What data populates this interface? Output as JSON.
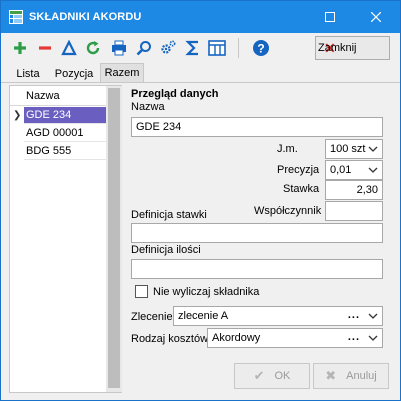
{
  "window": {
    "title": "SKŁADNIKI AKORDU",
    "accent_color": "#1e88e5"
  },
  "toolbar": {
    "icons": [
      "add-icon",
      "remove-icon",
      "delta-icon",
      "refresh-icon",
      "print-icon",
      "search-icon",
      "settings-icon",
      "sum-icon",
      "columns-icon",
      "help-icon"
    ],
    "close_label": "Zamknij"
  },
  "tabs": [
    {
      "label": "Lista",
      "active": false
    },
    {
      "label": "Pozycja",
      "active": false
    },
    {
      "label": "Razem",
      "active": true
    }
  ],
  "list": {
    "header": "Nazwa",
    "rows": [
      {
        "label": "GDE 234",
        "selected": true
      },
      {
        "label": "AGD 00001",
        "selected": false
      },
      {
        "label": "BDG 555",
        "selected": false
      }
    ],
    "selection_color": "#6a5fc1"
  },
  "detail": {
    "section_title": "Przegląd danych",
    "nazwa_label": "Nazwa",
    "nazwa_value": "GDE 234",
    "jm_label": "J.m.",
    "jm_value": "100 szt",
    "precyzja_label": "Precyzja",
    "precyzja_value": "0,01",
    "stawka_label": "Stawka",
    "stawka_value": "2,30",
    "wspolczynnik_label": "Współczynnik",
    "wspolczynnik_value": "",
    "definicja_stawki_label": "Definicja stawki",
    "definicja_stawki_value": "",
    "definicja_ilosci_label": "Definicja ilości",
    "definicja_ilosci_value": "",
    "nie_wyliczaj_label": "Nie wyliczaj składnika",
    "nie_wyliczaj_checked": false,
    "zlecenie_label": "Zlecenie",
    "zlecenie_value": "zlecenie A",
    "rodzaj_label": "Rodzaj kosztów",
    "rodzaj_value": "Akordowy",
    "ellipsis": "..."
  },
  "buttons": {
    "ok_label": "OK",
    "cancel_label": "Anuluj"
  }
}
